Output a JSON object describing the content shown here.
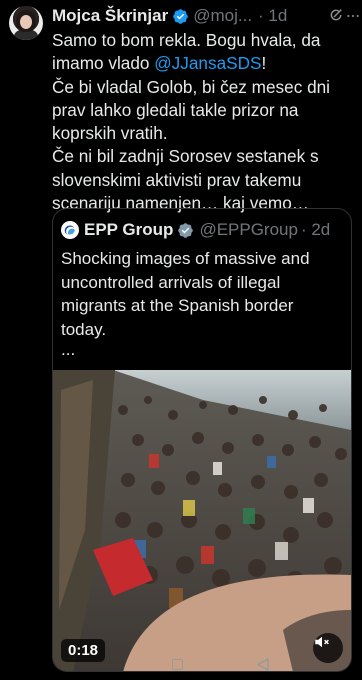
{
  "tweet": {
    "author_name": "Mojca Škrinjar",
    "handle": "@moj...",
    "time": "· 1d",
    "lines": [
      [
        {
          "t": "Samo to bom rekla. Bogu hvala, da"
        }
      ],
      [
        {
          "t": "imamo vlado "
        },
        {
          "t": "@JJansaSDS",
          "mention": true
        },
        {
          "t": "!"
        }
      ],
      [
        {
          "t": "Če bi vladal Golob, bi čez mesec dni"
        }
      ],
      [
        {
          "t": "prav lahko  gledali takle prizor na"
        }
      ],
      [
        {
          "t": "koprskih vratih."
        }
      ],
      [
        {
          "t": "Če ni bil zadnji Sorosev sestanek s"
        }
      ],
      [
        {
          "t": "slovenskimi aktivisti prav takemu"
        }
      ],
      [
        {
          "t": "scenariju  namenjen… kaj vemo…"
        }
      ]
    ],
    "accent_color": "#1d9bf0"
  },
  "quote": {
    "author_name": "EPP Group",
    "handle": "@EPPGroup",
    "time": "· 2d",
    "lines": [
      "Shocking images of massive and",
      "uncontrolled arrivals of illegal",
      "migrants at the Spanish border",
      "today."
    ],
    "more": "...",
    "video": {
      "duration": "0:18"
    }
  },
  "icons": {
    "verified": "verified-badge-icon",
    "grok": "grok-icon",
    "more": "more-icon",
    "mute": "speaker-muted-icon"
  }
}
